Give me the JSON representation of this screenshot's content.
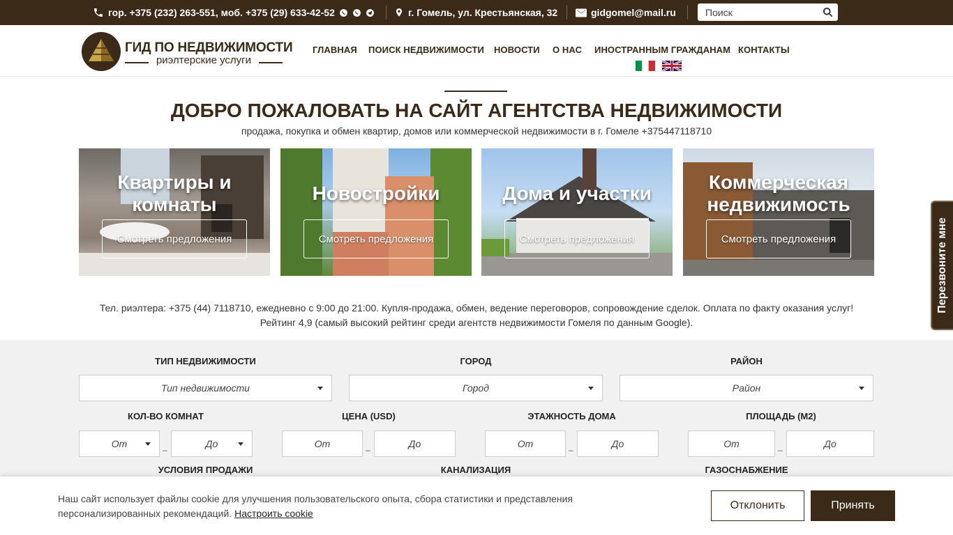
{
  "topbar": {
    "phones": "гор. +375 (232) 263-551, моб. +375 (29) 633-42-52",
    "address": "г. Гомель, ул. Крестьянская, 32",
    "email": "gidgomel@mail.ru",
    "search_placeholder": "Поиск"
  },
  "logo": {
    "title": "ГИД ПО НЕДВИЖИМОСТИ",
    "subtitle": "риэлтерские услуги"
  },
  "nav": [
    "ГЛАВНАЯ",
    "ПОИСК НЕДВИЖИМОСТИ",
    "НОВОСТИ",
    "О НАС",
    "ИНОСТРАННЫМ ГРАЖДАНАМ",
    "КОНТАКТЫ"
  ],
  "welcome": {
    "title": "ДОБРО ПОЖАЛОВАТЬ НА САЙТ АГЕНТСТВА НЕДВИЖИМОСТИ",
    "subtitle": "продажа, покупка и обмен квартир, домов или коммерческой недвижимости в г. Гомеле +375447118710"
  },
  "cards": [
    {
      "title": "Квартиры и комнаты",
      "button": "Смотреть предложения"
    },
    {
      "title": "Новостройки",
      "button": "Смотреть предложения"
    },
    {
      "title": "Дома и участки",
      "button": "Смотреть предложения"
    },
    {
      "title": "Коммерческая недвижимость",
      "button": "Смотреть предложения"
    }
  ],
  "info": {
    "line1": "Тел. риэлтера: +375 (44) 7118710, ежедневно с 9:00 до 21:00. Купля-продажа, обмен, ведение переговоров, сопровождение сделок. Оплата по факту оказания услуг!",
    "line2": "Рейтинг 4,9 (самый высокий рейтинг среди агентств недвижимости Гомеля по данным Google)."
  },
  "filter": {
    "type_label": "Тип недвижимости",
    "type_value": "Тип недвижимости",
    "city_label": "Город",
    "city_value": "Город",
    "district_label": "Район",
    "district_value": "Район",
    "rooms_label": "Кол-во комнат",
    "price_label": "Цена (USD)",
    "floors_label": "Этажность дома",
    "area_label": "Площадь (м2)",
    "from": "От",
    "to": "До",
    "sale_label": "Условия продажи",
    "sewer_label": "Канализация",
    "gas_label": "Газоснабжение"
  },
  "callback": "Перезвоните мне",
  "cookie": {
    "text": "Наш сайт использует файлы cookie для улучшения пользовательского опыта, сбора статистики и представления персонализированных рекомендаций.",
    "link": "Настроить cookie",
    "decline": "Отклонить",
    "accept": "Принять"
  },
  "colors": {
    "brand": "#3b2a17",
    "filter_bg": "#f1f1f1"
  }
}
